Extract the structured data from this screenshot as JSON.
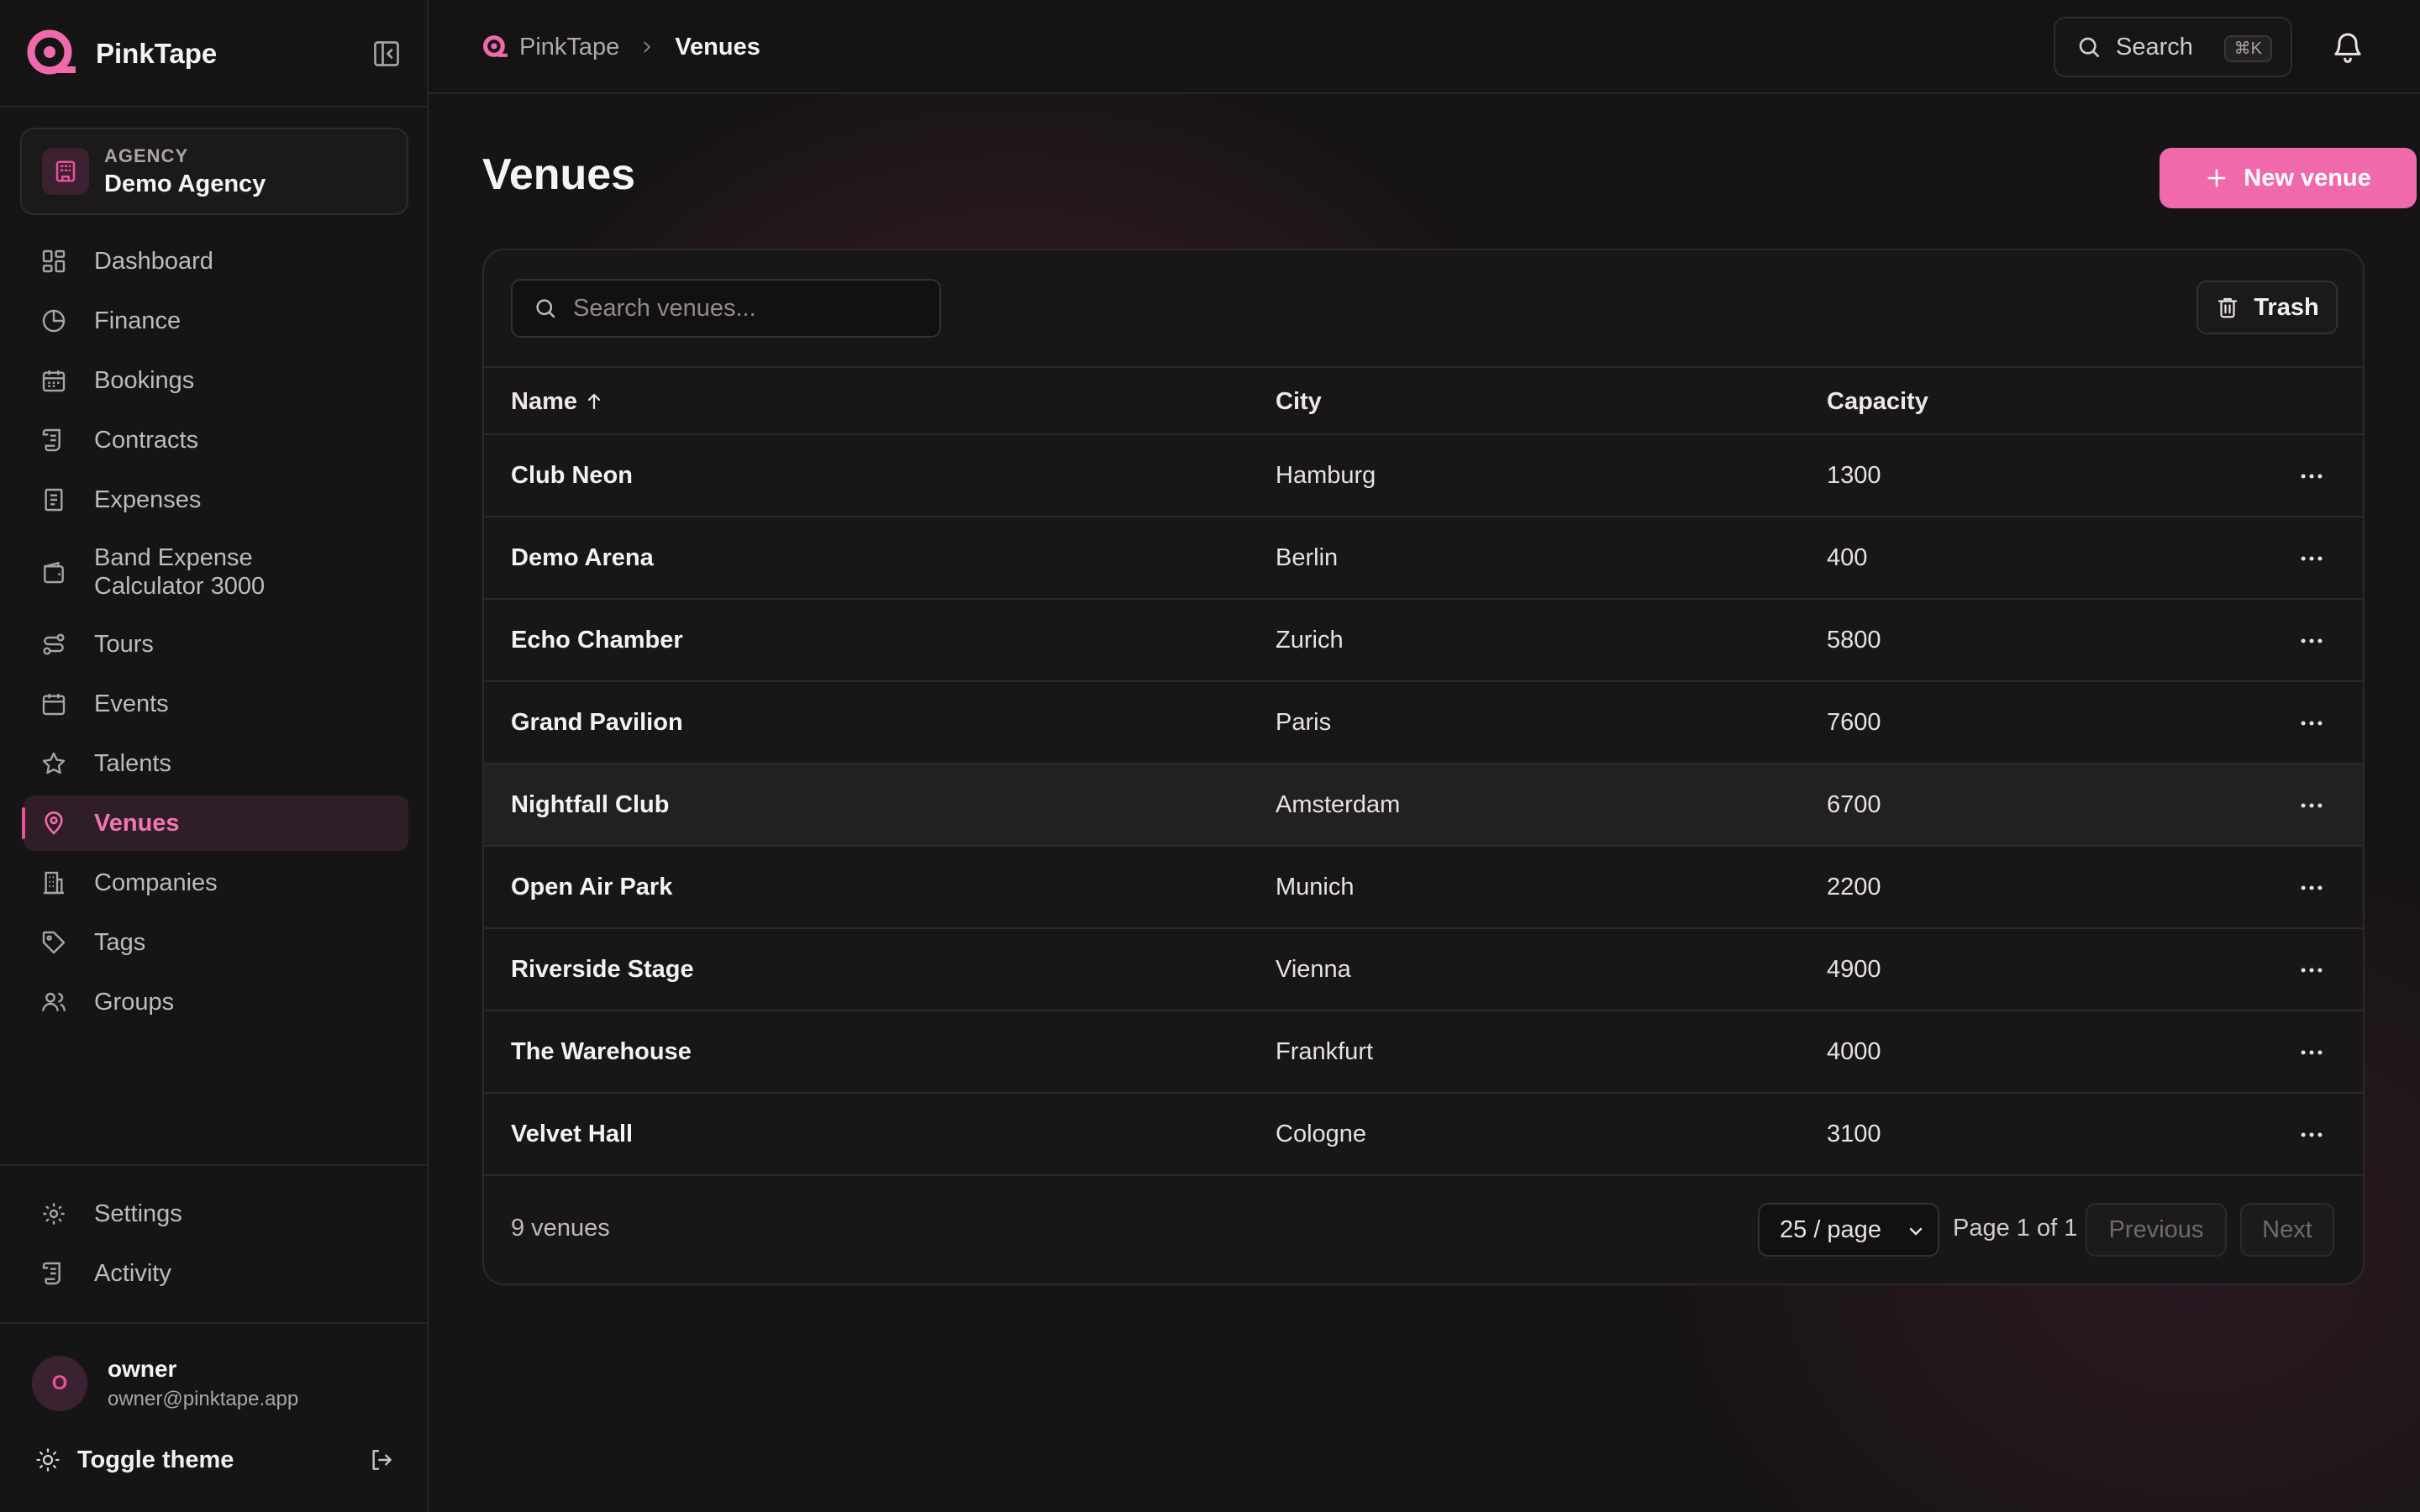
{
  "brand": {
    "name": "PinkTape"
  },
  "agency": {
    "kicker": "AGENCY",
    "name": "Demo Agency"
  },
  "nav": {
    "items": [
      {
        "label": "Dashboard"
      },
      {
        "label": "Finance"
      },
      {
        "label": "Bookings"
      },
      {
        "label": "Contracts"
      },
      {
        "label": "Expenses"
      },
      {
        "label": "Band Expense Calculator 3000"
      },
      {
        "label": "Tours"
      },
      {
        "label": "Events"
      },
      {
        "label": "Talents"
      },
      {
        "label": "Venues"
      },
      {
        "label": "Companies"
      },
      {
        "label": "Tags"
      },
      {
        "label": "Groups"
      }
    ],
    "bottom": [
      {
        "label": "Settings"
      },
      {
        "label": "Activity"
      }
    ]
  },
  "user": {
    "initial": "O",
    "name": "owner",
    "email": "owner@pinktape.app"
  },
  "theme": {
    "label": "Toggle theme"
  },
  "breadcrumb": {
    "root": "PinkTape",
    "current": "Venues"
  },
  "topbar": {
    "search_label": "Search",
    "search_shortcut": "⌘K"
  },
  "page": {
    "title": "Venues",
    "new_button": "New venue"
  },
  "table": {
    "search_placeholder": "Search venues...",
    "trash_label": "Trash",
    "columns": {
      "name": "Name",
      "city": "City",
      "capacity": "Capacity"
    },
    "rows": [
      {
        "name": "Club Neon",
        "city": "Hamburg",
        "capacity": "1300"
      },
      {
        "name": "Demo Arena",
        "city": "Berlin",
        "capacity": "400"
      },
      {
        "name": "Echo Chamber",
        "city": "Zurich",
        "capacity": "5800"
      },
      {
        "name": "Grand Pavilion",
        "city": "Paris",
        "capacity": "7600"
      },
      {
        "name": "Nightfall Club",
        "city": "Amsterdam",
        "capacity": "6700"
      },
      {
        "name": "Open Air Park",
        "city": "Munich",
        "capacity": "2200"
      },
      {
        "name": "Riverside Stage",
        "city": "Vienna",
        "capacity": "4900"
      },
      {
        "name": "The Warehouse",
        "city": "Frankfurt",
        "capacity": "4000"
      },
      {
        "name": "Velvet Hall",
        "city": "Cologne",
        "capacity": "3100"
      }
    ],
    "footer": {
      "count": "9 venues",
      "page_size": "25 / page",
      "page_info": "Page 1 of 1",
      "previous": "Previous",
      "next": "Next"
    }
  },
  "colors": {
    "accent": "#f06aab",
    "background": "#151314"
  }
}
